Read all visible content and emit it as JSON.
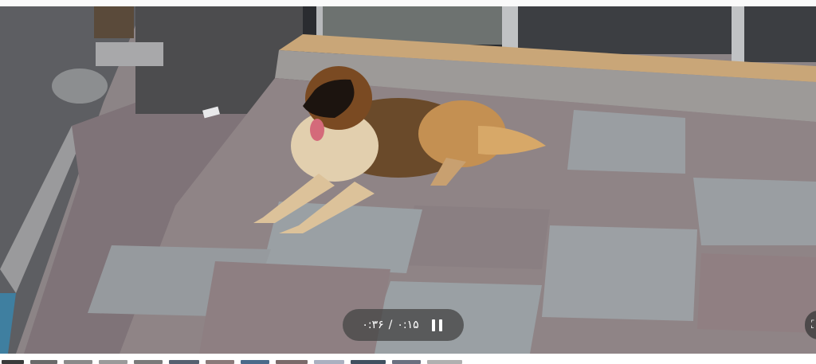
{
  "player": {
    "current_time": "۰:۱۵",
    "separator": "/",
    "duration": "۰:۳۶",
    "state": "playing",
    "pause_icon": "pause-icon",
    "fullscreen_icon": "fullscreen-icon"
  },
  "colors": {
    "controls_bg": "#464646",
    "control_text": "#ffffff"
  },
  "thumbnails": {
    "count": 13,
    "colors": [
      "#3a3a3a",
      "#6a6a6a",
      "#8a8a8a",
      "#9a9a9a",
      "#7a7a7a",
      "#556070",
      "#8a7a7a",
      "#4a6a8a",
      "#7a6a6a",
      "#aab0c0",
      "#405060",
      "#6a7080",
      "#b0b0b0"
    ]
  }
}
